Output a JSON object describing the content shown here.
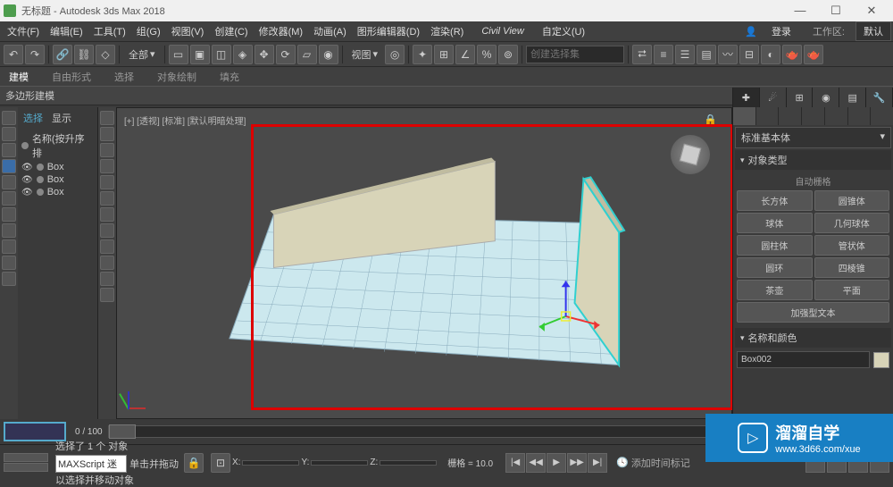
{
  "titlebar": {
    "title": "无标题 - Autodesk 3ds Max 2018",
    "min": "—",
    "max": "☐",
    "close": "✕"
  },
  "menu": {
    "items": [
      "文件(F)",
      "编辑(E)",
      "工具(T)",
      "组(G)",
      "视图(V)",
      "创建(C)",
      "修改器(M)",
      "动画(A)",
      "图形编辑器(D)",
      "渲染(R)",
      "Civil View",
      "自定义(U)"
    ],
    "login": "登录",
    "workspace_label": "工作区:",
    "workspace": "默认"
  },
  "toolbar1": {
    "all": "全部",
    "view": "视图",
    "create_sel": "创建选择集"
  },
  "ribbon": {
    "tabs": [
      "建模",
      "自由形式",
      "选择",
      "对象绘制",
      "填充"
    ],
    "sub": "多边形建模"
  },
  "scene": {
    "head_sel": "选择",
    "head_disp": "显示",
    "name_label": "名称(按升序排",
    "items": [
      "Box",
      "Box",
      "Box"
    ]
  },
  "viewport": {
    "label": "[+] [透视] [标准] [默认明暗处理]"
  },
  "cmd": {
    "dropdown": "标准基本体",
    "rollout_obj": "对象类型",
    "auto_grid": "自动栅格",
    "prims": [
      "长方体",
      "圆锥体",
      "球体",
      "几何球体",
      "圆柱体",
      "管状体",
      "圆环",
      "四棱锥",
      "茶壶",
      "平面",
      "加强型文本"
    ],
    "rollout_name": "名称和颜色",
    "obj_name": "Box002"
  },
  "timeline": {
    "text": "0 / 100"
  },
  "status": {
    "sel_msg": "选择了 1 个 对象",
    "hint": "单击并拖动以选择并移动对象",
    "maxscript": "MAXScript 迷",
    "x": "",
    "y": "",
    "z": "",
    "grid_label": "栅格 = 10.0",
    "add_time": "添加时间标记"
  },
  "watermark": {
    "cn": "溜溜自学",
    "url": "www.3d66.com/xue"
  }
}
